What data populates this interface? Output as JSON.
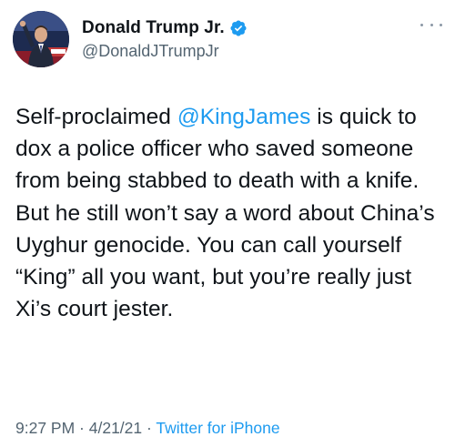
{
  "author": {
    "display_name": "Donald Trump Jr.",
    "handle": "@DonaldJTrumpJr",
    "verified_icon": "verified-badge-icon",
    "more_icon": "more-options-icon"
  },
  "tweet": {
    "text_before_mention": "Self-proclaimed ",
    "mention": "@KingJames",
    "text_after_mention": " is quick to dox a police officer who saved someone from being stabbed to death with a knife. But he still won’t say a word about China’s Uyghur genocide. You can call yourself “King” all you want, but you’re really just Xi’s court jester."
  },
  "meta": {
    "time": "9:27 PM",
    "separator_1": " · ",
    "date": "4/21/21",
    "separator_2": " · ",
    "source": "Twitter for iPhone"
  },
  "colors": {
    "link": "#1d9bf0",
    "secondary_text": "#536471",
    "primary_text": "#0f1419",
    "background": "#ffffff"
  }
}
